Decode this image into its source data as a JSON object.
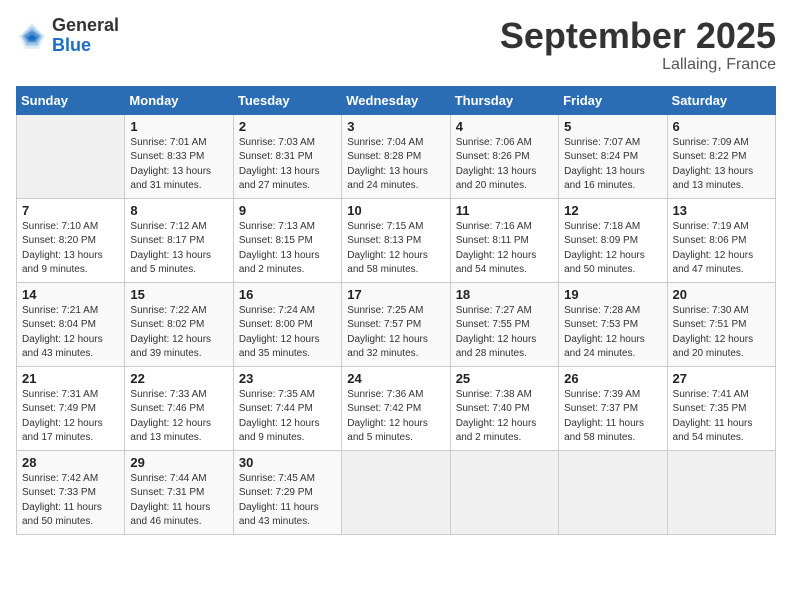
{
  "header": {
    "logo_general": "General",
    "logo_blue": "Blue",
    "month": "September 2025",
    "location": "Lallaing, France"
  },
  "days_of_week": [
    "Sunday",
    "Monday",
    "Tuesday",
    "Wednesday",
    "Thursday",
    "Friday",
    "Saturday"
  ],
  "weeks": [
    [
      {
        "day": "",
        "info": ""
      },
      {
        "day": "1",
        "info": "Sunrise: 7:01 AM\nSunset: 8:33 PM\nDaylight: 13 hours and 31 minutes."
      },
      {
        "day": "2",
        "info": "Sunrise: 7:03 AM\nSunset: 8:31 PM\nDaylight: 13 hours and 27 minutes."
      },
      {
        "day": "3",
        "info": "Sunrise: 7:04 AM\nSunset: 8:28 PM\nDaylight: 13 hours and 24 minutes."
      },
      {
        "day": "4",
        "info": "Sunrise: 7:06 AM\nSunset: 8:26 PM\nDaylight: 13 hours and 20 minutes."
      },
      {
        "day": "5",
        "info": "Sunrise: 7:07 AM\nSunset: 8:24 PM\nDaylight: 13 hours and 16 minutes."
      },
      {
        "day": "6",
        "info": "Sunrise: 7:09 AM\nSunset: 8:22 PM\nDaylight: 13 hours and 13 minutes."
      }
    ],
    [
      {
        "day": "7",
        "info": "Sunrise: 7:10 AM\nSunset: 8:20 PM\nDaylight: 13 hours and 9 minutes."
      },
      {
        "day": "8",
        "info": "Sunrise: 7:12 AM\nSunset: 8:17 PM\nDaylight: 13 hours and 5 minutes."
      },
      {
        "day": "9",
        "info": "Sunrise: 7:13 AM\nSunset: 8:15 PM\nDaylight: 13 hours and 2 minutes."
      },
      {
        "day": "10",
        "info": "Sunrise: 7:15 AM\nSunset: 8:13 PM\nDaylight: 12 hours and 58 minutes."
      },
      {
        "day": "11",
        "info": "Sunrise: 7:16 AM\nSunset: 8:11 PM\nDaylight: 12 hours and 54 minutes."
      },
      {
        "day": "12",
        "info": "Sunrise: 7:18 AM\nSunset: 8:09 PM\nDaylight: 12 hours and 50 minutes."
      },
      {
        "day": "13",
        "info": "Sunrise: 7:19 AM\nSunset: 8:06 PM\nDaylight: 12 hours and 47 minutes."
      }
    ],
    [
      {
        "day": "14",
        "info": "Sunrise: 7:21 AM\nSunset: 8:04 PM\nDaylight: 12 hours and 43 minutes."
      },
      {
        "day": "15",
        "info": "Sunrise: 7:22 AM\nSunset: 8:02 PM\nDaylight: 12 hours and 39 minutes."
      },
      {
        "day": "16",
        "info": "Sunrise: 7:24 AM\nSunset: 8:00 PM\nDaylight: 12 hours and 35 minutes."
      },
      {
        "day": "17",
        "info": "Sunrise: 7:25 AM\nSunset: 7:57 PM\nDaylight: 12 hours and 32 minutes."
      },
      {
        "day": "18",
        "info": "Sunrise: 7:27 AM\nSunset: 7:55 PM\nDaylight: 12 hours and 28 minutes."
      },
      {
        "day": "19",
        "info": "Sunrise: 7:28 AM\nSunset: 7:53 PM\nDaylight: 12 hours and 24 minutes."
      },
      {
        "day": "20",
        "info": "Sunrise: 7:30 AM\nSunset: 7:51 PM\nDaylight: 12 hours and 20 minutes."
      }
    ],
    [
      {
        "day": "21",
        "info": "Sunrise: 7:31 AM\nSunset: 7:49 PM\nDaylight: 12 hours and 17 minutes."
      },
      {
        "day": "22",
        "info": "Sunrise: 7:33 AM\nSunset: 7:46 PM\nDaylight: 12 hours and 13 minutes."
      },
      {
        "day": "23",
        "info": "Sunrise: 7:35 AM\nSunset: 7:44 PM\nDaylight: 12 hours and 9 minutes."
      },
      {
        "day": "24",
        "info": "Sunrise: 7:36 AM\nSunset: 7:42 PM\nDaylight: 12 hours and 5 minutes."
      },
      {
        "day": "25",
        "info": "Sunrise: 7:38 AM\nSunset: 7:40 PM\nDaylight: 12 hours and 2 minutes."
      },
      {
        "day": "26",
        "info": "Sunrise: 7:39 AM\nSunset: 7:37 PM\nDaylight: 11 hours and 58 minutes."
      },
      {
        "day": "27",
        "info": "Sunrise: 7:41 AM\nSunset: 7:35 PM\nDaylight: 11 hours and 54 minutes."
      }
    ],
    [
      {
        "day": "28",
        "info": "Sunrise: 7:42 AM\nSunset: 7:33 PM\nDaylight: 11 hours and 50 minutes."
      },
      {
        "day": "29",
        "info": "Sunrise: 7:44 AM\nSunset: 7:31 PM\nDaylight: 11 hours and 46 minutes."
      },
      {
        "day": "30",
        "info": "Sunrise: 7:45 AM\nSunset: 7:29 PM\nDaylight: 11 hours and 43 minutes."
      },
      {
        "day": "",
        "info": ""
      },
      {
        "day": "",
        "info": ""
      },
      {
        "day": "",
        "info": ""
      },
      {
        "day": "",
        "info": ""
      }
    ]
  ]
}
